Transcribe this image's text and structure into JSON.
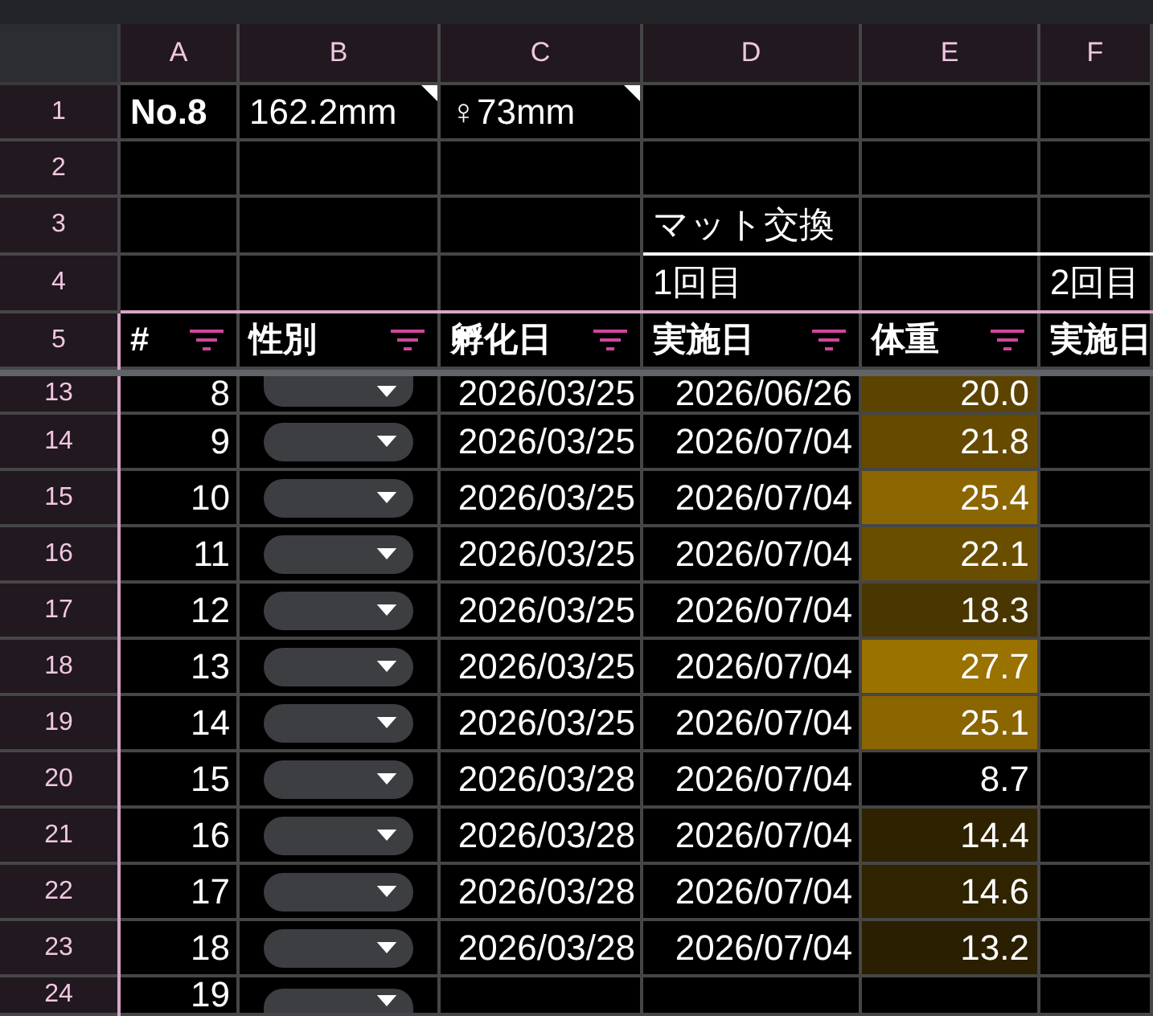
{
  "column_letters": [
    "A",
    "B",
    "C",
    "D",
    "E",
    "F"
  ],
  "top_rows": [
    {
      "row_number": "1",
      "cells": {
        "a": {
          "text": "No.8",
          "bold": true
        },
        "b": {
          "text": "162.2mm",
          "note": true
        },
        "c": {
          "text": "♀73mm",
          "note": true
        }
      }
    },
    {
      "row_number": "2"
    },
    {
      "row_number": "3",
      "cells": {
        "d": {
          "text": "マット交換"
        }
      }
    },
    {
      "row_number": "4",
      "cells": {
        "d": {
          "text": "1回目",
          "border_top": true
        },
        "e": {
          "border_top": true
        },
        "f": {
          "text": "2回目",
          "border_top": true
        }
      }
    }
  ],
  "table": {
    "header_row_number": "5",
    "columns": [
      {
        "label": "#",
        "filter": true
      },
      {
        "label": "性別",
        "filter": true
      },
      {
        "label": "孵化日",
        "filter": true
      },
      {
        "label": "実施日",
        "filter": true
      },
      {
        "label": "体重",
        "filter": true
      },
      {
        "label": "実施日",
        "filter": false
      }
    ],
    "rows": [
      {
        "row_number": "13",
        "number": "8",
        "dropdown": true,
        "hatch_date": "2026/03/25",
        "date": "2026/06/26",
        "weight": "20.0",
        "color": "#5c4400"
      },
      {
        "row_number": "14",
        "number": "9",
        "dropdown": true,
        "hatch_date": "2026/03/25",
        "date": "2026/07/04",
        "weight": "21.8",
        "color": "#654a00"
      },
      {
        "row_number": "15",
        "number": "10",
        "dropdown": true,
        "hatch_date": "2026/03/25",
        "date": "2026/07/04",
        "weight": "25.4",
        "color": "#8c6600"
      },
      {
        "row_number": "16",
        "number": "11",
        "dropdown": true,
        "hatch_date": "2026/03/25",
        "date": "2026/07/04",
        "weight": "22.1",
        "color": "#6a4e00"
      },
      {
        "row_number": "17",
        "number": "12",
        "dropdown": true,
        "hatch_date": "2026/03/25",
        "date": "2026/07/04",
        "weight": "18.3",
        "color": "#4a3600"
      },
      {
        "row_number": "18",
        "number": "13",
        "dropdown": true,
        "hatch_date": "2026/03/25",
        "date": "2026/07/04",
        "weight": "27.7",
        "color": "#9a7200"
      },
      {
        "row_number": "19",
        "number": "14",
        "dropdown": true,
        "hatch_date": "2026/03/25",
        "date": "2026/07/04",
        "weight": "25.1",
        "color": "#8a6500"
      },
      {
        "row_number": "20",
        "number": "15",
        "dropdown": true,
        "hatch_date": "2026/03/28",
        "date": "2026/07/04",
        "weight": "8.7"
      },
      {
        "row_number": "21",
        "number": "16",
        "dropdown": true,
        "hatch_date": "2026/03/28",
        "date": "2026/07/04",
        "weight": "14.4",
        "color": "#2e2200"
      },
      {
        "row_number": "22",
        "number": "17",
        "dropdown": true,
        "hatch_date": "2026/03/28",
        "date": "2026/07/04",
        "weight": "14.6",
        "color": "#2f2300"
      },
      {
        "row_number": "23",
        "number": "18",
        "dropdown": true,
        "hatch_date": "2026/03/28",
        "date": "2026/07/04",
        "weight": "13.2",
        "color": "#2a1f00"
      },
      {
        "row_number": "24",
        "number": "19",
        "dropdown": true
      }
    ]
  }
}
